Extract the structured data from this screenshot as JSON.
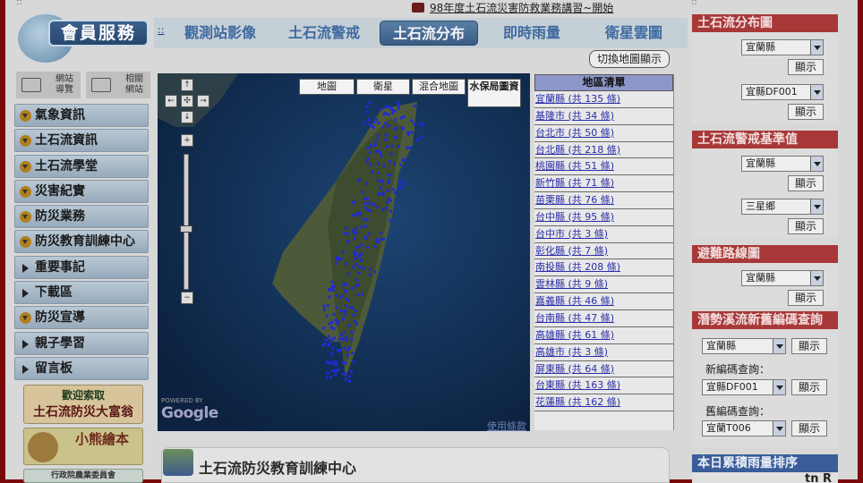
{
  "marquee": {
    "text": "98年度土石流災害防救業務講習~開始"
  },
  "corner_dots": {
    "left": "::",
    "right": "::"
  },
  "member_logo": {
    "label": "會員服務"
  },
  "site_nav": [
    {
      "label": "網站導覽",
      "icon": "sitemap-icon"
    },
    {
      "label": "相關網站",
      "icon": "related-sites-icon"
    }
  ],
  "menu": [
    {
      "label": "氣象資訊",
      "bullet": "circle"
    },
    {
      "label": "土石流資訊",
      "bullet": "circle"
    },
    {
      "label": "土石流學堂",
      "bullet": "circle"
    },
    {
      "label": "災害紀實",
      "bullet": "circle"
    },
    {
      "label": "防災業務",
      "bullet": "circle"
    },
    {
      "label": "防災教育訓練中心",
      "bullet": "circle"
    },
    {
      "label": "重要事記",
      "bullet": "triangle"
    },
    {
      "label": "下載區",
      "bullet": "triangle"
    },
    {
      "label": "防災宣導",
      "bullet": "circle"
    },
    {
      "label": "親子學習",
      "bullet": "triangle"
    },
    {
      "label": "留言板",
      "bullet": "triangle"
    }
  ],
  "banners": {
    "b1_line1": "歡迎索取",
    "b1_line2": "土石流防災大富翁",
    "b2_text": "小熊繪本",
    "b3_text": "行政院農業委員會"
  },
  "tabs": {
    "dots": "::",
    "items": [
      {
        "label": "觀測站影像"
      },
      {
        "label": "土石流警戒"
      },
      {
        "label": "土石流分布",
        "active": true
      },
      {
        "label": "即時雨量"
      },
      {
        "label": "衛星雲圖"
      }
    ]
  },
  "toggle_button": {
    "label": "切換地圖顯示"
  },
  "map": {
    "types": [
      "地圖",
      "衛星",
      "混合地圖",
      "水保局圖資"
    ],
    "active_type": "水保局圖資",
    "powered_by": "POWERED BY",
    "google": "Google",
    "terms": "使用條款",
    "controls": {
      "up": "↑",
      "left": "←",
      "center": "✣",
      "right": "→",
      "down": "↓",
      "zoom_in": "+",
      "zoom_out": "−"
    },
    "zoom_level_fraction": 0.55,
    "colors": {
      "points": "#1f2ad6",
      "land": "#4d5a3a"
    }
  },
  "region_list": {
    "header": "地區清單",
    "items": [
      "宜蘭縣 (共 135 條)",
      "基隆市 (共 34 條)",
      "台北市 (共 50 條)",
      "台北縣 (共 218 條)",
      "桃園縣 (共 51 條)",
      "新竹縣 (共 71 條)",
      "苗栗縣 (共 76 條)",
      "台中縣 (共 95 條)",
      "台中市 (共 3 條)",
      "彰化縣 (共 7 條)",
      "南投縣 (共 208 條)",
      "雲林縣 (共 9 條)",
      "嘉義縣 (共 46 條)",
      "台南縣 (共 47 條)",
      "高雄縣 (共 61 條)",
      "高雄市 (共 3 條)",
      "屏東縣 (共 64 條)",
      "台東縣 (共 163 條)",
      "花蓮縣 (共 162 條)"
    ]
  },
  "section": {
    "title": "土石流防災教育訓練中心"
  },
  "right_panel": {
    "dist_title": "土石流分布圖",
    "dist_select1": "宜蘭縣",
    "dist_btn1": "顯示",
    "dist_select2": "宜縣DF001",
    "dist_btn2": "顯示",
    "alert_title": "土石流警戒基準值",
    "alert_select1": "宜蘭縣",
    "alert_btn1": "顯示",
    "alert_select2": "三星鄉",
    "alert_btn2": "顯示",
    "evac_title": "避難路線圖",
    "evac_select": "宜蘭縣",
    "evac_btn": "顯示",
    "code_title": "潛勢溪流新舊編碼查詢",
    "code_select": "宜蘭縣",
    "code_btn": "顯示",
    "new_code_label": "新編碼查詢：",
    "new_code_select": "宜縣DF001",
    "new_code_btn": "顯示",
    "old_code_label": "舊編碼查詢：",
    "old_code_select": "宜蘭T006",
    "old_code_btn": "顯示",
    "rain_title": "本日累積雨量排序",
    "rain_cut": "tn R"
  },
  "colors": {
    "accent_red": "#a83838",
    "tab_active": "#3a5c84",
    "link_blue": "#2b2fa8"
  }
}
